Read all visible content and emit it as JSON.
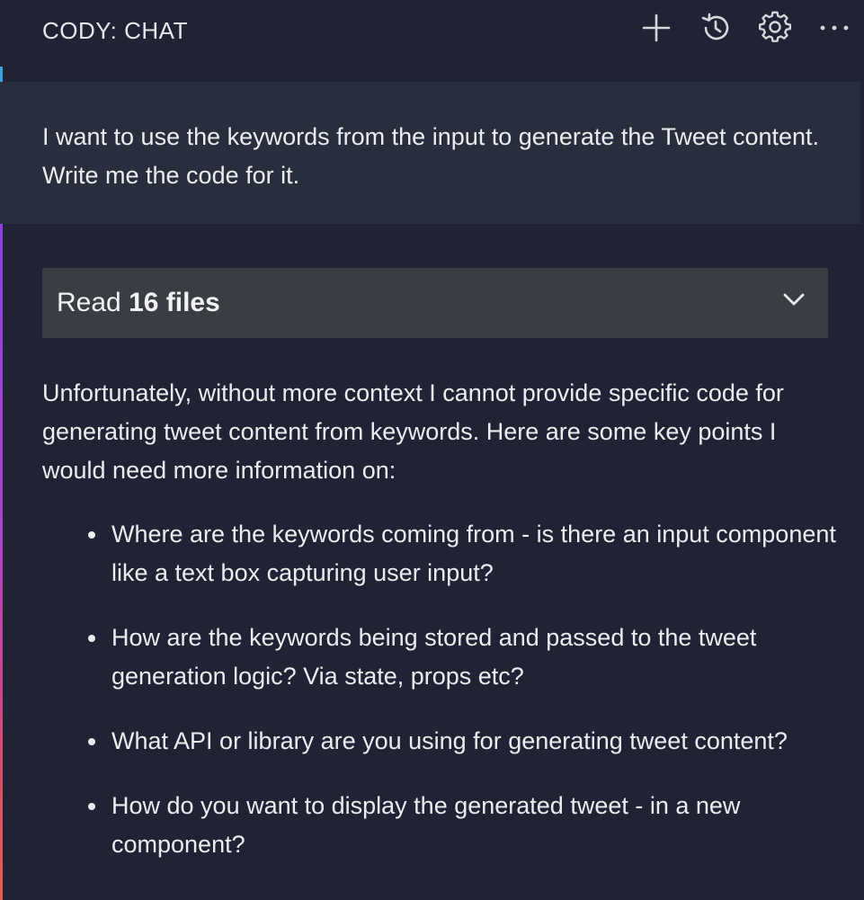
{
  "header": {
    "title": "CODY: CHAT",
    "actions": [
      {
        "name": "new-chat",
        "icon": "plus-icon"
      },
      {
        "name": "history",
        "icon": "history-icon"
      },
      {
        "name": "settings",
        "icon": "gear-icon"
      },
      {
        "name": "more",
        "icon": "ellipsis-icon"
      }
    ]
  },
  "human_message": {
    "text": "I want to use the keywords from the input to generate the Tweet content. Write me the code for it."
  },
  "assistant_message": {
    "context": {
      "prefix": "Read ",
      "count_label": "16 files",
      "icon": "chevron-down-icon"
    },
    "intro": "Unfortunately, without more context I cannot provide specific code for generating tweet content from keywords. Here are some key points I would need more information on:",
    "bullets": [
      "Where are the keywords coming from - is there an input component like a text box capturing user input?",
      "How are the keywords being stored and passed to the tweet generation logic? Via state, props etc?",
      "What API or library are you using for generating tweet content?",
      "How do you want to display the generated tweet - in a new component?"
    ]
  },
  "colors": {
    "background": "#1f2333",
    "human_bg": "#292e3d",
    "context_bg": "#3b3d44",
    "text": "#ececf0",
    "accent_blue": "#3aa3e0",
    "accent_purple": "#8a3fe6",
    "accent_red": "#f05a4a"
  }
}
